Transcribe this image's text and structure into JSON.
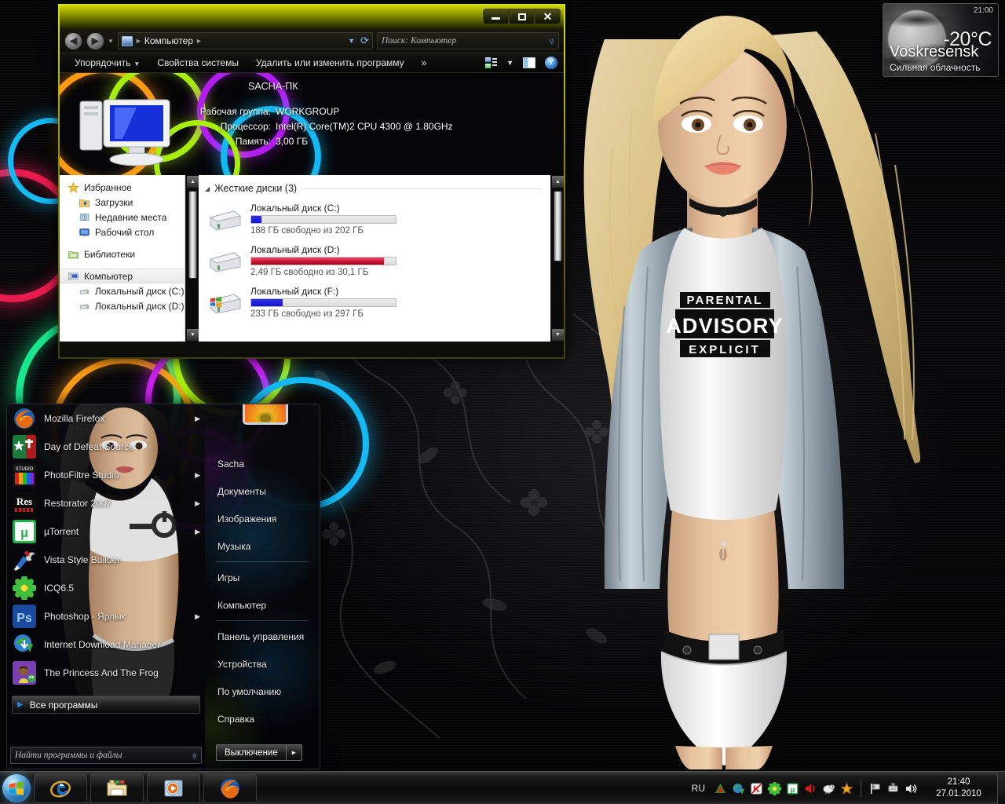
{
  "gadget": {
    "time": "21:00",
    "temp": "-20°C",
    "city": "Voskresensk",
    "condition": "Сильная облачность"
  },
  "explorer": {
    "window_buttons": {
      "minimize": "minimize-icon",
      "maximize": "maximize-icon",
      "close": "close-icon"
    },
    "breadcrumb": {
      "root": "Компьютер",
      "sep": "►"
    },
    "search": {
      "placeholder": "Поиск: Компьютер",
      "value": ""
    },
    "toolbar": {
      "organize": "Упорядочить",
      "system_properties": "Свойства системы",
      "uninstall_change": "Удалить или изменить программу",
      "overflow": "»"
    },
    "system_info": {
      "computer_name": "SACHA-ПК",
      "rows": [
        {
          "label": "Рабочая группа:",
          "value": "WORKGROUP"
        },
        {
          "label": "Процессор:",
          "value": "Intel(R) Core(TM)2 CPU     4300  @ 1.80GHz"
        },
        {
          "label": "Память:",
          "value": "3,00 ГБ"
        }
      ]
    },
    "nav_pane": [
      {
        "label": "Избранное",
        "icon": "star-icon",
        "level": 0,
        "selected": false
      },
      {
        "label": "Загрузки",
        "icon": "downloads-folder-icon",
        "level": 1,
        "selected": false
      },
      {
        "label": "Недавние места",
        "icon": "recent-places-icon",
        "level": 1,
        "selected": false
      },
      {
        "label": "Рабочий стол",
        "icon": "desktop-icon",
        "level": 1,
        "selected": false
      },
      {
        "label": "Библиотеки",
        "icon": "libraries-icon",
        "level": 0,
        "selected": false
      },
      {
        "label": "Компьютер",
        "icon": "computer-icon",
        "level": 0,
        "selected": true
      },
      {
        "label": "Локальный диск (C:)",
        "icon": "drive-icon",
        "level": 1,
        "selected": false
      },
      {
        "label": "Локальный диск (D:)",
        "icon": "drive-icon",
        "level": 1,
        "selected": false
      }
    ],
    "group_header": "Жесткие диски (3)",
    "drives": [
      {
        "name": "Локальный диск (C:)",
        "free_text": "188 ГБ свободно из 202 ГБ",
        "used_pct": 7,
        "bar_color": "blue",
        "icon": "hdd-icon"
      },
      {
        "name": "Локальный диск (D:)",
        "free_text": "2,49 ГБ свободно из 30,1 ГБ",
        "used_pct": 92,
        "bar_color": "red",
        "icon": "hdd-icon"
      },
      {
        "name": "Локальный диск (F:)",
        "free_text": "233 ГБ свободно из 297 ГБ",
        "used_pct": 22,
        "bar_color": "blue",
        "icon": "hdd-windows-icon"
      }
    ]
  },
  "start_menu": {
    "user": "Sacha",
    "avatar_icon": "flower-avatar",
    "programs": [
      {
        "label": "Mozilla Firefox",
        "icon": "firefox-icon",
        "has_arrow": true
      },
      {
        "label": "Day of Defeat Source",
        "icon": "dod-source-icon",
        "has_arrow": false
      },
      {
        "label": "PhotoFiltre Studio",
        "icon": "photofiltre-icon",
        "has_arrow": true
      },
      {
        "label": "Restorator 2007",
        "icon": "restorator-icon",
        "has_arrow": true
      },
      {
        "label": "µTorrent",
        "icon": "utorrent-icon",
        "has_arrow": true
      },
      {
        "label": "Vista Style Builder",
        "icon": "vista-style-builder-icon",
        "has_arrow": false
      },
      {
        "label": "ICQ6.5",
        "icon": "icq-icon",
        "has_arrow": false
      },
      {
        "label": "Photoshop - Ярлык",
        "icon": "photoshop-icon",
        "has_arrow": true
      },
      {
        "label": "Internet Download Manager",
        "icon": "idm-icon",
        "has_arrow": false
      },
      {
        "label": "The Princess And The Frog",
        "icon": "princess-frog-icon",
        "has_arrow": false
      }
    ],
    "all_programs": "Все программы",
    "search_placeholder": "Найти программы и файлы",
    "right_items": [
      {
        "label": "Sacha",
        "sep_after": false
      },
      {
        "label": "Документы",
        "sep_after": false
      },
      {
        "label": "Изображения",
        "sep_after": false
      },
      {
        "label": "Музыка",
        "sep_after": true
      },
      {
        "label": "Игры",
        "sep_after": false
      },
      {
        "label": "Компьютер",
        "sep_after": true
      },
      {
        "label": "Панель управления",
        "sep_after": false
      },
      {
        "label": "Устройства",
        "sep_after": false
      },
      {
        "label": "По умолчанию",
        "sep_after": false
      },
      {
        "label": "Справка",
        "sep_after": false
      }
    ],
    "shutdown": "Выключение",
    "shutdown_arrow": "►"
  },
  "taskbar": {
    "start_orb": "windows-start-orb",
    "buttons": [
      {
        "name": "internet-explorer",
        "icon": "ie-icon"
      },
      {
        "name": "windows-explorer",
        "icon": "folder-icon"
      },
      {
        "name": "windows-media-player",
        "icon": "media-player-icon"
      },
      {
        "name": "mozilla-firefox",
        "icon": "firefox-icon"
      }
    ],
    "language": "RU",
    "tray_icons": [
      "nvidia-icon",
      "internet-download-manager-icon",
      "kaspersky-icon",
      "icq-icon",
      "utorrent-icon",
      "volume-red-icon",
      "sheep-icon",
      "star-icon"
    ],
    "tray_system_icons": [
      "action-flag-icon",
      "network-icon",
      "volume-icon"
    ],
    "clock_time": "21:40",
    "clock_date": "27.01.2010"
  },
  "wallpaper": {
    "shirt_line1": "PARENTAL",
    "shirt_line2": "ADVISORY",
    "shirt_line3": "EXPLICIT"
  }
}
